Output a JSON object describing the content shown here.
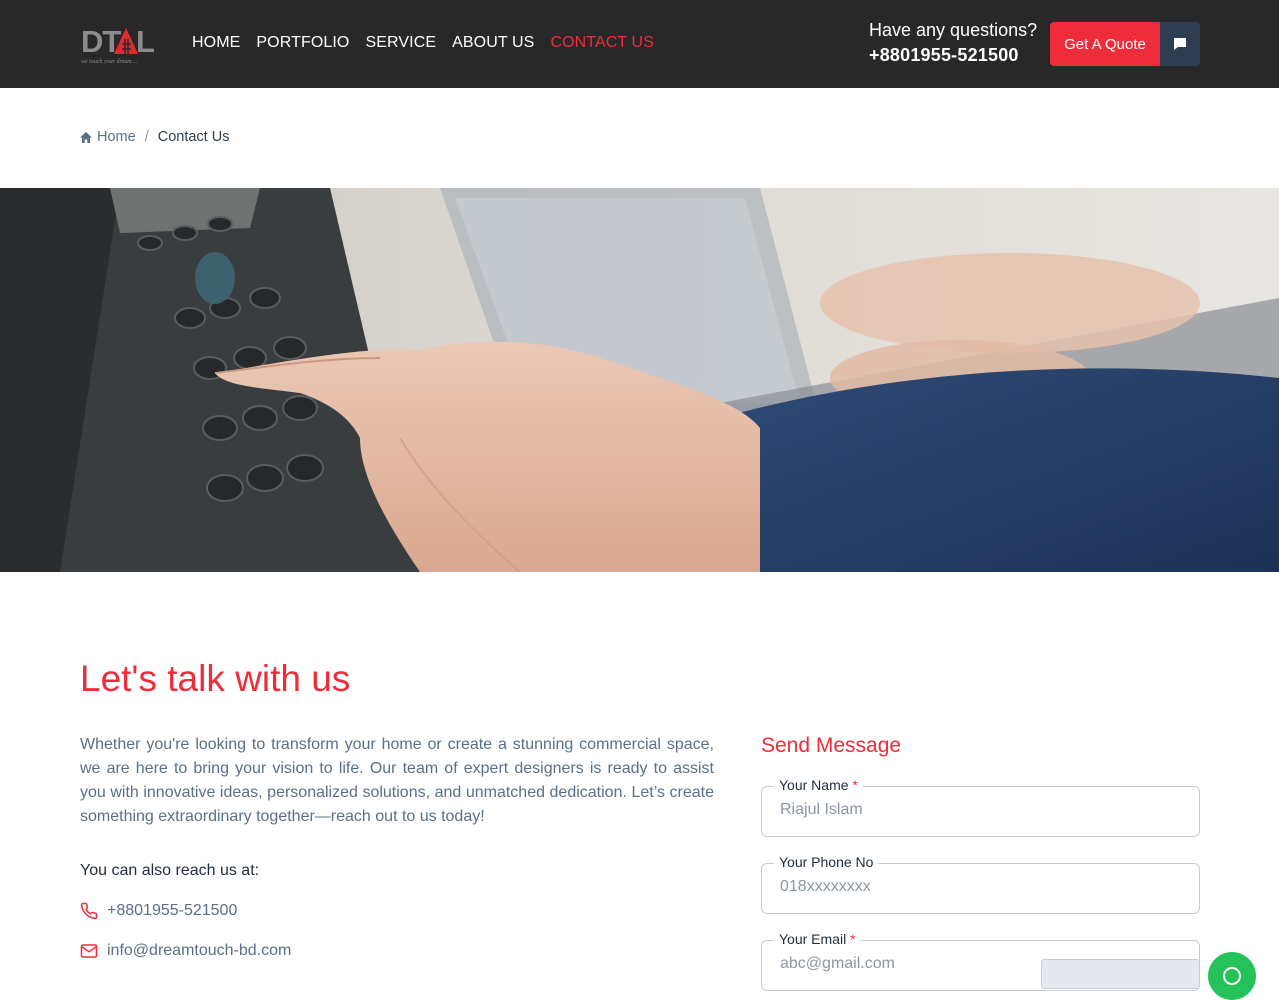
{
  "header": {
    "logo_text": "DTAL",
    "logo_tagline": "we touch your dream....",
    "nav": [
      {
        "label": "HOME",
        "active": false
      },
      {
        "label": "PORTFOLIO",
        "active": false
      },
      {
        "label": "SERVICE",
        "active": false
      },
      {
        "label": "ABOUT US",
        "active": false
      },
      {
        "label": "CONTACT US",
        "active": true
      }
    ],
    "question": "Have any questions?",
    "phone": "+8801955-521500",
    "quote_label": "Get A Quote",
    "chat_icon": "chat-bubble-icon"
  },
  "breadcrumb": {
    "home": "Home",
    "separator": "/",
    "current": "Contact Us"
  },
  "hero": {
    "icon": "telephone-keypad-photo"
  },
  "contact": {
    "title": "Let's talk with us",
    "intro": "Whether you're looking to transform your home or create a stunning commercial space, we are here to bring your vision to life. Our team of expert designers is ready to assist you with innovative ideas, personalized solutions, and unmatched dedication. Let’s create something extraordinary together—reach out to us today!",
    "reach_label": "You can also reach us at:",
    "phone": "+8801955-521500",
    "email": "info@dreamtouch-bd.com"
  },
  "form": {
    "title": "Send Message",
    "name_label": "Your Name",
    "name_placeholder": "Riajul Islam",
    "phone_label": "Your Phone No",
    "phone_placeholder": "018xxxxxxxx",
    "email_label": "Your Email",
    "email_placeholder": "abc@gmail.com",
    "required_mark": "*"
  },
  "colors": {
    "accent": "#ef2d3a",
    "header_bg": "#282828",
    "dark_navy": "#2e3d52",
    "muted_text": "#5a6f8a",
    "whatsapp": "#25c25a"
  }
}
